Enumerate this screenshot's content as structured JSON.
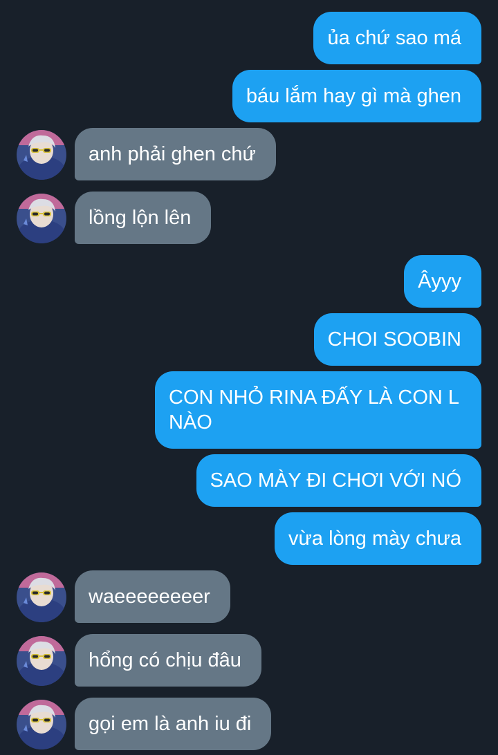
{
  "conversation": {
    "messages": [
      {
        "from": "me",
        "text": "ủa chứ sao má"
      },
      {
        "from": "me",
        "text": "báu lắm hay gì mà ghen"
      },
      {
        "from": "them",
        "text": "anh phải ghen chứ"
      },
      {
        "from": "them",
        "text": "lồng lộn lên"
      },
      {
        "from": "me",
        "text": "Âyyy"
      },
      {
        "from": "me",
        "text": "CHOI SOOBIN"
      },
      {
        "from": "me",
        "text": "CON NHỎ RINA ĐẤY LÀ CON L NÀO"
      },
      {
        "from": "me",
        "text": "SAO MÀY ĐI CHƠI VỚI NÓ"
      },
      {
        "from": "me",
        "text": "vừa lòng mày chưa"
      },
      {
        "from": "them",
        "text": "waeeeeeeeer"
      },
      {
        "from": "them",
        "text": "hổng có chịu đâu"
      },
      {
        "from": "them",
        "text": "gọi em là anh iu đi"
      }
    ]
  },
  "colors": {
    "background": "#18202a",
    "sent_bubble": "#1da1f2",
    "received_bubble": "#657786",
    "text": "#ffffff"
  }
}
